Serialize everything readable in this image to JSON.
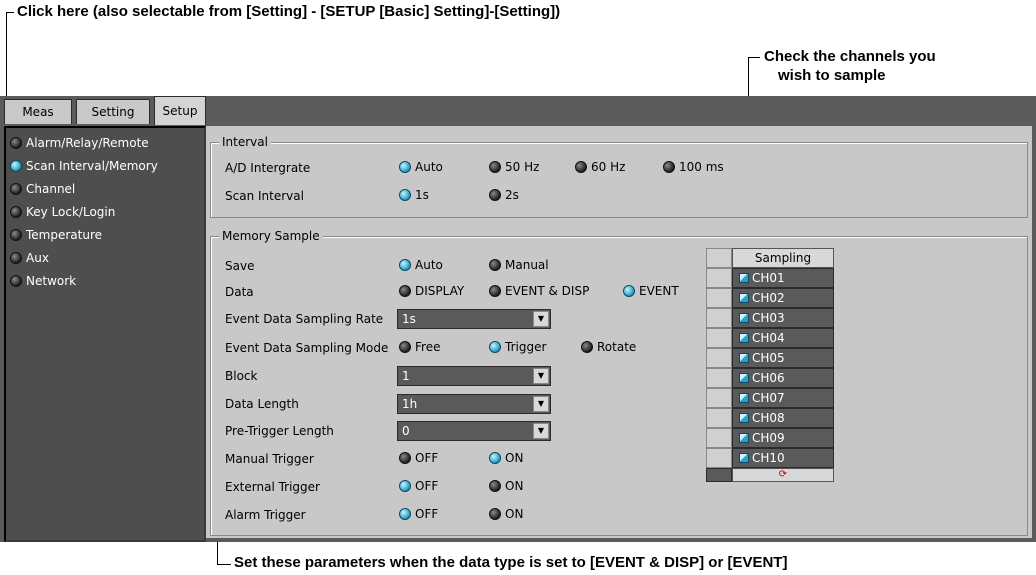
{
  "annotations": {
    "top": "Click here (also selectable from [Setting] - [SETUP [Basic] Setting]-[Setting])",
    "right_line1": "Check the channels you",
    "right_line2": "wish to sample",
    "bottom": "Set these parameters when the data type is set to [EVENT & DISP] or [EVENT]"
  },
  "tabs": [
    "Meas",
    "Setting",
    "Setup"
  ],
  "active_tab": "Setup",
  "sidebar": {
    "items": [
      {
        "label": "Alarm/Relay/Remote",
        "selected": false
      },
      {
        "label": "Scan Interval/Memory",
        "selected": true
      },
      {
        "label": "Channel",
        "selected": false
      },
      {
        "label": "Key Lock/Login",
        "selected": false
      },
      {
        "label": "Temperature",
        "selected": false
      },
      {
        "label": "Aux",
        "selected": false
      },
      {
        "label": "Network",
        "selected": false
      }
    ]
  },
  "interval": {
    "title": "Interval",
    "ad_label": "A/D Intergrate",
    "ad_options": [
      "Auto",
      "50 Hz",
      "60 Hz",
      "100 ms"
    ],
    "ad_selected": "Auto",
    "scan_label": "Scan Interval",
    "scan_options": [
      "1s",
      "2s"
    ],
    "scan_selected": "1s"
  },
  "memory": {
    "title": "Memory Sample",
    "save_label": "Save",
    "save_options": [
      "Auto",
      "Manual"
    ],
    "save_selected": "Auto",
    "data_label": "Data",
    "data_options": [
      "DISPLAY",
      "EVENT & DISP",
      "EVENT"
    ],
    "data_selected": "EVENT",
    "rate_label": "Event Data Sampling Rate",
    "rate_value": "1s",
    "mode_label": "Event Data Sampling Mode",
    "mode_options": [
      "Free",
      "Trigger",
      "Rotate"
    ],
    "mode_selected": "Trigger",
    "block_label": "Block",
    "block_value": "1",
    "length_label": "Data Length",
    "length_value": "1h",
    "pretrig_label": "Pre-Trigger Length",
    "pretrig_value": "0",
    "manual_label": "Manual Trigger",
    "manual_options": [
      "OFF",
      "ON"
    ],
    "manual_selected": "ON",
    "external_label": "External Trigger",
    "external_options": [
      "OFF",
      "ON"
    ],
    "external_selected": "OFF",
    "alarm_label": "Alarm Trigger",
    "alarm_options": [
      "OFF",
      "ON"
    ],
    "alarm_selected": "OFF"
  },
  "sampling": {
    "header": "Sampling",
    "channels": [
      "CH01",
      "CH02",
      "CH03",
      "CH04",
      "CH05",
      "CH06",
      "CH07",
      "CH08",
      "CH09",
      "CH10"
    ],
    "footer_icon": "refresh-icon"
  }
}
